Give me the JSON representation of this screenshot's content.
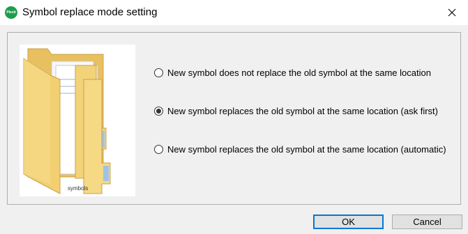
{
  "window": {
    "title": "Symbol replace mode setting",
    "app_icon_text": "Plexit",
    "icon": "app-logo-icon"
  },
  "image": {
    "caption": "symbols",
    "icon": "folder-icon"
  },
  "options": [
    {
      "label": "New symbol does not replace the old symbol at the same location",
      "checked": false
    },
    {
      "label": "New symbol replaces the old symbol at the same location (ask first)",
      "checked": true
    },
    {
      "label": "New symbol replaces the old symbol at the same location (automatic)",
      "checked": false
    }
  ],
  "buttons": {
    "ok": "OK",
    "cancel": "Cancel"
  },
  "colors": {
    "accent": "#0078d7",
    "app_icon": "#1f9d4c",
    "folder": "#f2cf70"
  }
}
